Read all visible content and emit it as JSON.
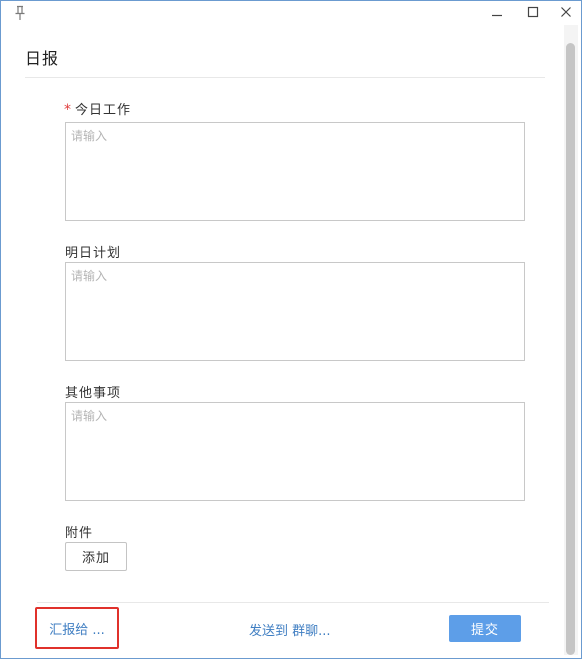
{
  "header": {
    "title": "日报"
  },
  "form": {
    "today": {
      "label": "今日工作",
      "required_mark": "*",
      "value": "",
      "placeholder": "请输入"
    },
    "tomorrow": {
      "label": "明日计划",
      "value": "",
      "placeholder": "请输入"
    },
    "other": {
      "label": "其他事项",
      "value": "",
      "placeholder": "请输入"
    },
    "attachment": {
      "label": "附件",
      "add_label": "添加"
    }
  },
  "footer": {
    "report_to_label": "汇报给 ...",
    "send_to_label": "发送到",
    "group_chat_label": "群聊...",
    "submit_label": "提交"
  },
  "icons": {
    "pin": "pin-icon",
    "minimize": "minimize-icon",
    "maximize": "maximize-icon",
    "close": "close-icon"
  },
  "colors": {
    "accent": "#5d9ee8",
    "link": "#3f7ec2",
    "required": "#e03c3c",
    "highlight_border": "#e0312b",
    "window_border": "#6b9bd0"
  }
}
